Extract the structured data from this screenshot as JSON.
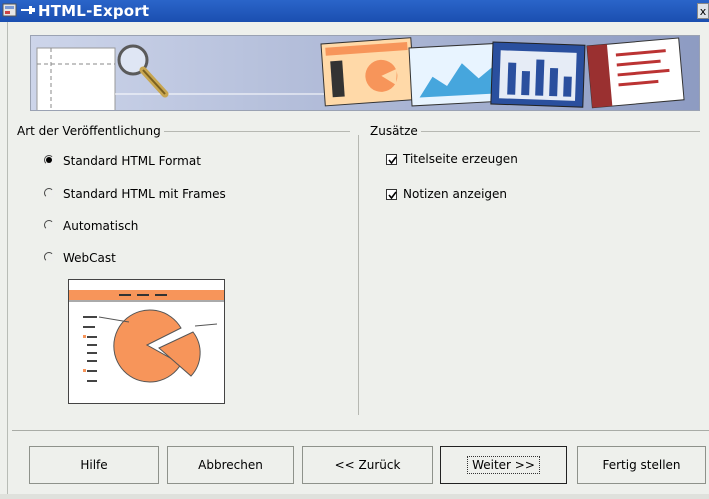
{
  "window": {
    "title": "HTML-Export",
    "close_glyph": "x"
  },
  "sections": {
    "publication": {
      "label": "Art der Veröffentlichung",
      "options": [
        {
          "label": "Standard HTML Format",
          "selected": true
        },
        {
          "label": "Standard HTML mit Frames",
          "selected": false
        },
        {
          "label": "Automatisch",
          "selected": false
        },
        {
          "label": "WebCast",
          "selected": false
        }
      ]
    },
    "extras": {
      "label": "Zusätze",
      "options": [
        {
          "label": "Titelseite erzeugen",
          "checked": true
        },
        {
          "label": "Notizen anzeigen",
          "checked": true
        }
      ]
    }
  },
  "buttons": {
    "help": "Hilfe",
    "cancel": "Abbrechen",
    "back": "<< Zurück",
    "next": "Weiter >>",
    "finish": "Fertig stellen"
  },
  "colors": {
    "titlebar": "#2a65c9",
    "accent_orange": "#f7955a",
    "banner_bg": "#bfc8e0"
  },
  "icons": [
    "app-icon",
    "pin-icon",
    "close-icon",
    "magnifier-icon",
    "check-icon"
  ]
}
